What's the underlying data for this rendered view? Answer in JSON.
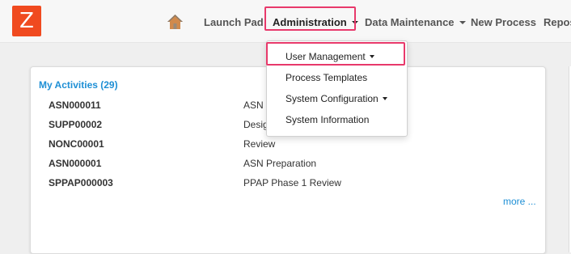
{
  "header": {
    "logo_letter": "Z",
    "nav": [
      {
        "label": "Launch Pad"
      },
      {
        "label": "Administration"
      },
      {
        "label": "Data Maintenance"
      },
      {
        "label": "New Process"
      },
      {
        "label": "Repos"
      }
    ]
  },
  "admin_menu": {
    "items": [
      {
        "label": "User Management"
      },
      {
        "label": "Process Templates"
      },
      {
        "label": "System Configuration"
      },
      {
        "label": "System Information"
      }
    ]
  },
  "activities": {
    "title": "My Activities (29)",
    "rows": [
      {
        "id": "ASN000011",
        "desc": "ASN"
      },
      {
        "id": "SUPP00002",
        "desc": "Desig"
      },
      {
        "id": "NONC00001",
        "desc": "Review"
      },
      {
        "id": "ASN000001",
        "desc": "ASN Preparation"
      },
      {
        "id": "SPPAP000003",
        "desc": "PPAP Phase 1 Review"
      }
    ],
    "more_label": "more ..."
  },
  "colors": {
    "brand": "#f04a1f",
    "link": "#1e8fd5",
    "highlight": "#e8396b"
  }
}
